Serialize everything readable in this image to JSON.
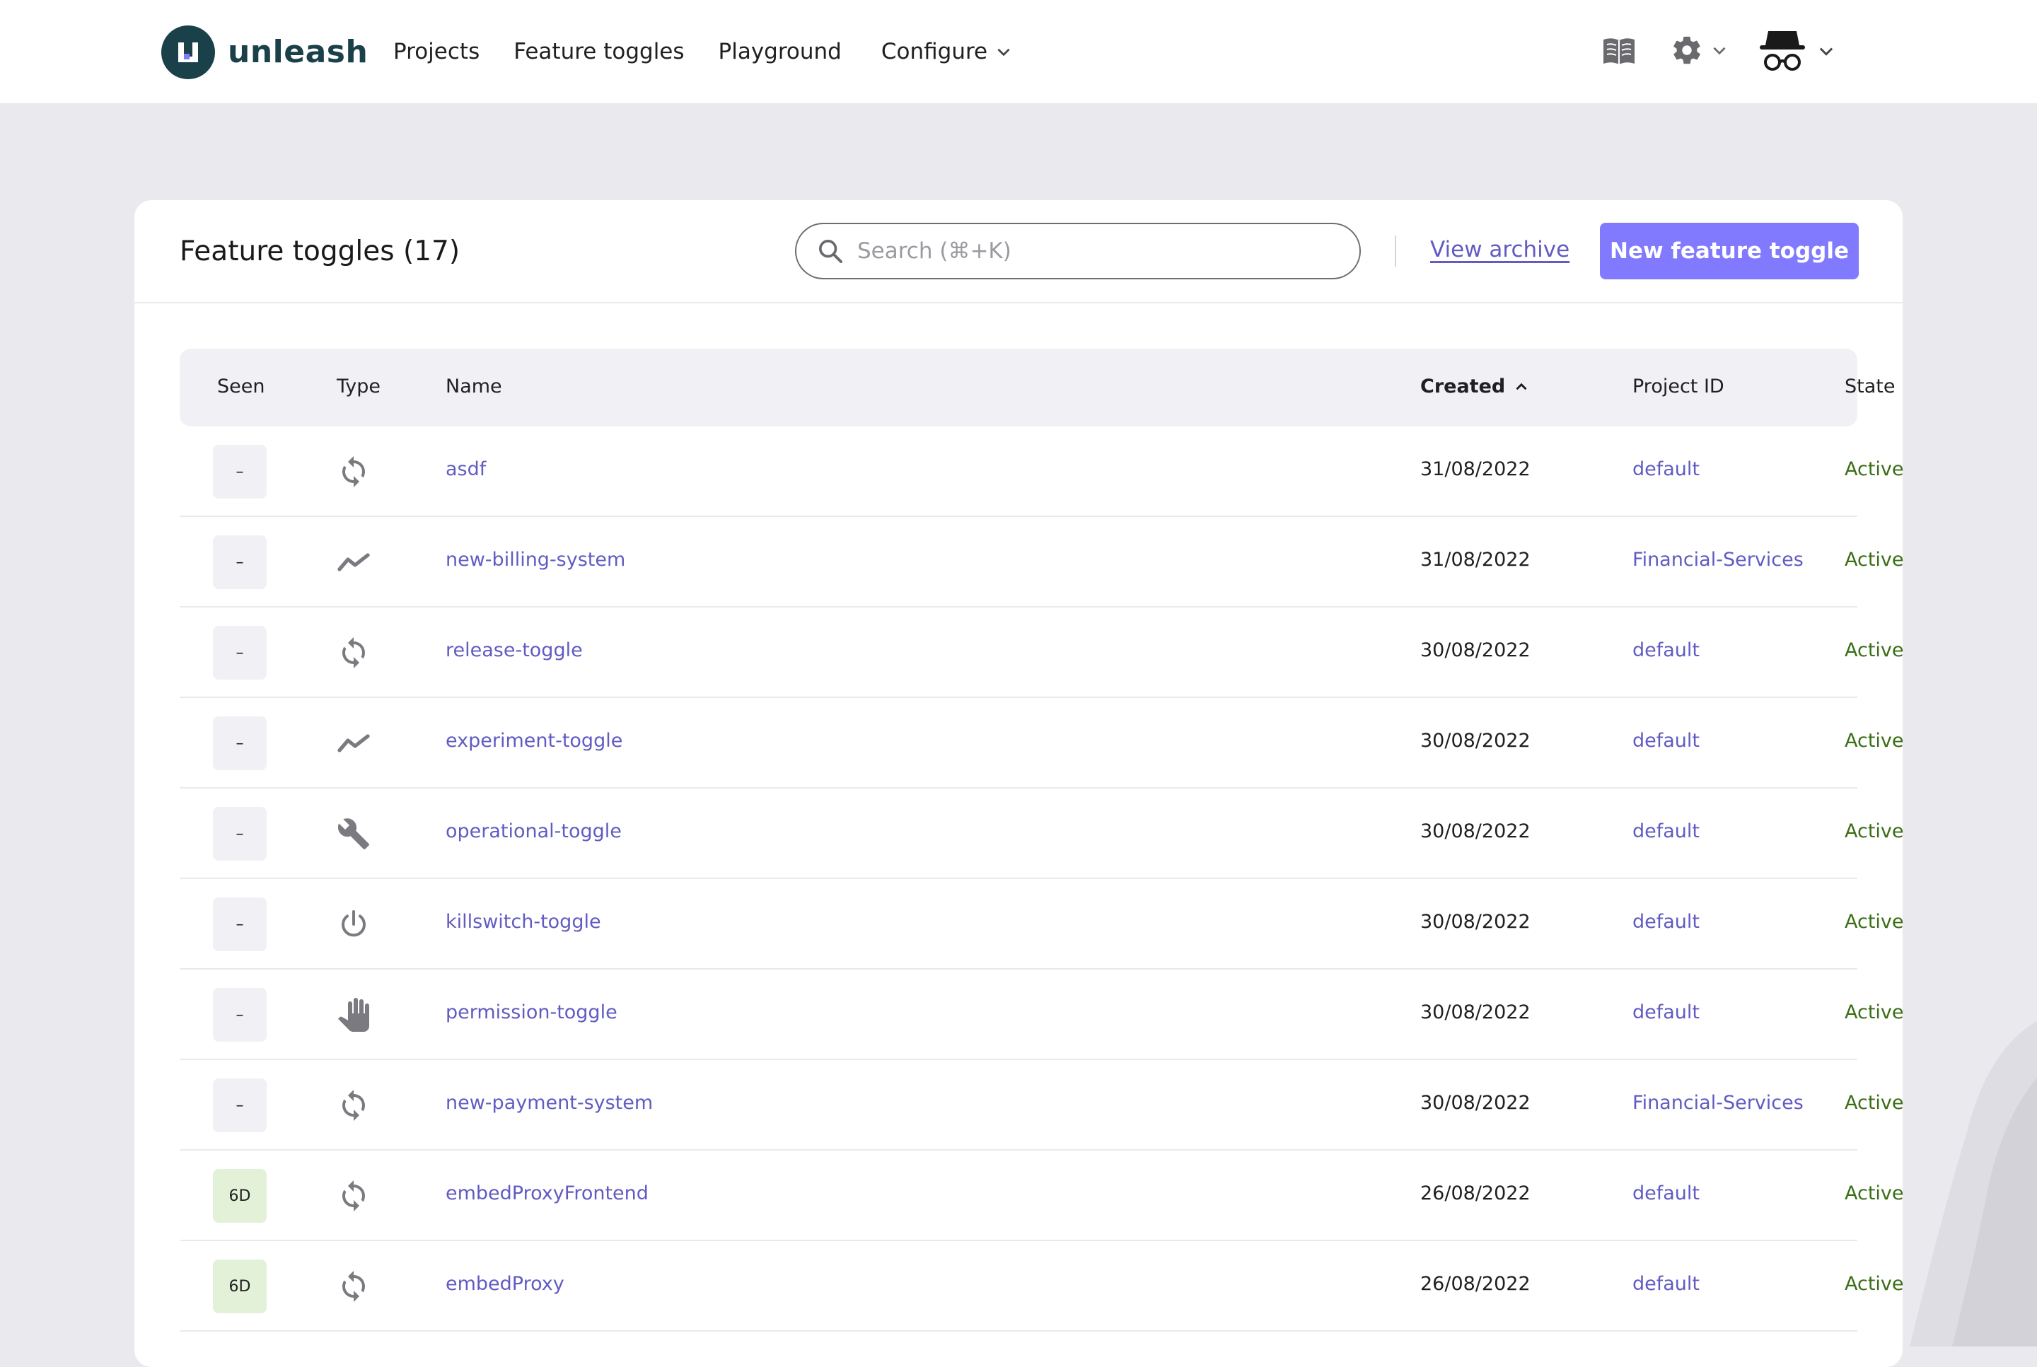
{
  "brand": {
    "name": "unleash"
  },
  "nav": {
    "items": [
      "Projects",
      "Feature toggles",
      "Playground",
      "Configure"
    ]
  },
  "page": {
    "title": "Feature toggles (17)",
    "search_placeholder": "Search (⌘+K)",
    "view_archive": "View archive",
    "new_button": "New feature toggle"
  },
  "table": {
    "headers": {
      "seen": "Seen",
      "type": "Type",
      "name": "Name",
      "created": "Created",
      "project": "Project ID",
      "state": "State"
    },
    "sorted_column": "created",
    "sort_direction": "ascending-arrow",
    "rows": [
      {
        "seen": "–",
        "type": "release",
        "name": "asdf",
        "created": "31/08/2022",
        "project": "default",
        "state": "Active"
      },
      {
        "seen": "–",
        "type": "experiment",
        "name": "new-billing-system",
        "created": "31/08/2022",
        "project": "Financial-Services",
        "state": "Active"
      },
      {
        "seen": "–",
        "type": "release",
        "name": "release-toggle",
        "created": "30/08/2022",
        "project": "default",
        "state": "Active"
      },
      {
        "seen": "–",
        "type": "experiment",
        "name": "experiment-toggle",
        "created": "30/08/2022",
        "project": "default",
        "state": "Active"
      },
      {
        "seen": "–",
        "type": "operational",
        "name": "operational-toggle",
        "created": "30/08/2022",
        "project": "default",
        "state": "Active"
      },
      {
        "seen": "–",
        "type": "kill-switch",
        "name": "killswitch-toggle",
        "created": "30/08/2022",
        "project": "default",
        "state": "Active"
      },
      {
        "seen": "–",
        "type": "permission",
        "name": "permission-toggle",
        "created": "30/08/2022",
        "project": "default",
        "state": "Active"
      },
      {
        "seen": "–",
        "type": "release",
        "name": "new-payment-system",
        "created": "30/08/2022",
        "project": "Financial-Services",
        "state": "Active"
      },
      {
        "seen": "6D",
        "type": "release",
        "name": "embedProxyFrontend",
        "created": "26/08/2022",
        "project": "default",
        "state": "Active"
      },
      {
        "seen": "6D",
        "type": "release",
        "name": "embedProxy",
        "created": "26/08/2022",
        "project": "default",
        "state": "Active"
      }
    ]
  },
  "colors": {
    "accent": "#817afe",
    "link": "#615bc2",
    "active": "#3b6e16",
    "seen_recent_bg": "#e2f1d8",
    "brand_dark": "#1a4049"
  }
}
